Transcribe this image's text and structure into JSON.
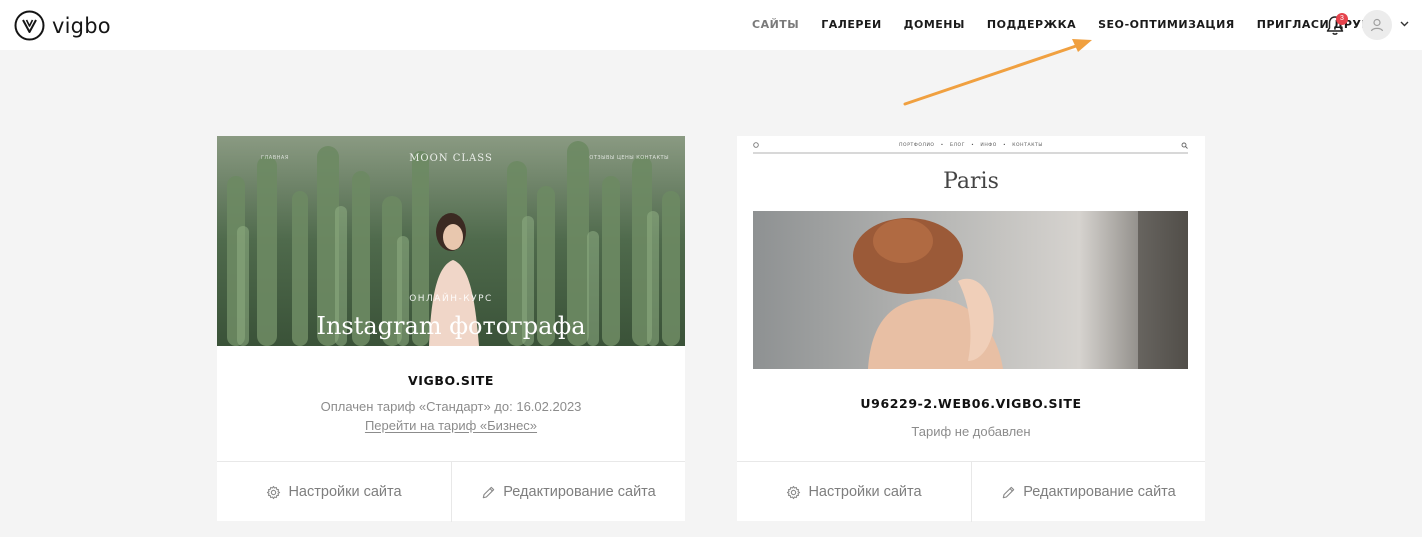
{
  "header": {
    "logo_text": "vigbo",
    "nav": [
      {
        "label": "САЙТЫ",
        "active": true
      },
      {
        "label": "ГАЛЕРЕИ",
        "active": false
      },
      {
        "label": "ДОМЕНЫ",
        "active": false
      },
      {
        "label": "ПОДДЕРЖКА",
        "active": false
      },
      {
        "label": "SEO-ОПТИМИЗАЦИЯ",
        "active": false
      },
      {
        "label": "ПРИГЛАСИ ДРУГА",
        "active": false
      }
    ],
    "notifications_count": "3",
    "icons": {
      "notifications": "bell-icon",
      "avatar": "user-icon",
      "menu": "chevron-down-icon"
    }
  },
  "colors": {
    "accent_arrow": "#f0a040",
    "badge": "#e5434c",
    "background": "#f4f4f4"
  },
  "sites": [
    {
      "preview": {
        "brand": "MOON CLASS",
        "menu_left": "ГЛАВНАЯ",
        "menu_right": "ОТЗЫВЫ   ЦЕНЫ   КОНТАКТЫ",
        "kicker": "ОНЛАЙН-КУРС",
        "headline": "Instagram фотографа"
      },
      "name": "VIGBO.SITE",
      "plan": "Оплачен тариф «Стандарт» до: 16.02.2023",
      "upgrade_link": "Перейти на тариф «Бизнес»",
      "settings_label": "Настройки сайта",
      "edit_label": "Редактирование сайта"
    },
    {
      "preview": {
        "nav": "ПОРТФОЛИО • БЛОГ • ИНФО • КОНТАКТЫ",
        "title": "Paris"
      },
      "name": "U96229-2.WEB06.VIGBO.SITE",
      "plan": "Тариф не добавлен",
      "settings_label": "Настройки сайта",
      "edit_label": "Редактирование сайта"
    }
  ]
}
